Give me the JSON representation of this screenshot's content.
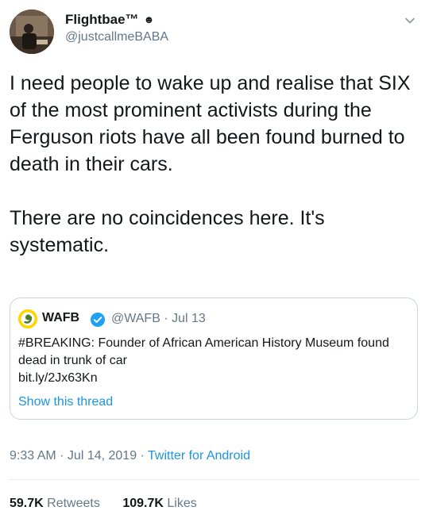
{
  "tweet": {
    "author": {
      "display_name": "Flightbae™",
      "badge": "☻",
      "handle": "@justcallmeBABA",
      "avatar_icon": "profile-photo"
    },
    "text": "I need people to wake up and realise that SIX of the most prominent activists during the Ferguson riots have all been found burned to death in their cars.\n\nThere are no coincidences here. It's systematic.",
    "quoted": {
      "name": "WAFB",
      "handle_date": "@WAFB · Jul 13",
      "text": "#BREAKING: Founder of African American History Museum found dead in trunk of car\nbit.ly/2Jx63Kn",
      "thread_link": "Show this thread",
      "avatar_color": "#ffd400"
    },
    "meta": {
      "time_date": "9:33 AM · Jul 14, 2019 · ",
      "app": "Twitter for Android"
    },
    "stats": {
      "retweets_count": "59.7K",
      "retweets_label": "Retweets",
      "likes_count": "109.7K",
      "likes_label": "Likes"
    }
  },
  "colors": {
    "link": "#1b95e0",
    "secondary_text": "#657786",
    "border": "#ccd6dd"
  }
}
